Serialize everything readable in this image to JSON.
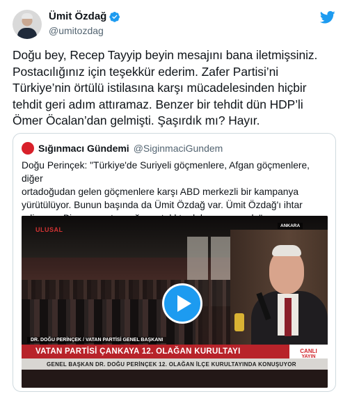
{
  "author": {
    "name": "Ümit Özdağ",
    "handle": "@umitozdag",
    "verified": true
  },
  "tweet": {
    "text": "Doğu bey, Recep Tayyip beyin mesajını bana iletmişsiniz.\nPostacılığınız için teşekkür ederim. Zafer Partisi’ni\nTürkiye’nin örtülü istilasına karşı mücadelesinden hiçbir\ntehdit geri adım attıramaz. Benzer bir tehdit dün HDP’li\nÖmer Öcalan’dan gelmişti. Şaşırdık mı? Hayır."
  },
  "quoted": {
    "name": "Sığınmacı Gündemi",
    "handle": "@SiginmaciGundem",
    "text": "Doğu Perinçek: \"Türkiye'de Suriyeli göçmenlere, Afgan göçmenlere, diğer\nortadoğudan gelen göçmenlere karşı ABD merkezli bir kampanya\nyürütülüyor. Bunun başında da Ümit Özdağ var. Ümit Özdağ'ı ihtar\nediyoruz. Biz onu pıstıracağız, ortalıkta dolaşamayacak.\"",
    "video": {
      "channel_logo": "ULUSAL",
      "location": "ANKARA",
      "speaker_label": "DR. DOĞU PERİNÇEK / VATAN PARTİSİ GENEL BAŞKANI",
      "headline": "VATAN PARTİSİ ÇANKAYA 12. OLAĞAN KURULTAYI",
      "live_label_1": "CANLI",
      "live_label_2": "YAYIN",
      "subline": "GENEL BAŞKAN DR. DOĞU PERİNÇEK 12. OLAĞAN İLÇE KURULTAYINDA KONUŞUYOR"
    }
  },
  "colors": {
    "twitter_blue": "#1d9bf0",
    "text": "#0f1419",
    "muted": "#536471",
    "border": "#cfd9de",
    "banner_red": "#b8232a"
  },
  "icons": {
    "verified": "verified-badge-icon",
    "brand": "twitter-bird-icon",
    "play": "play-icon"
  }
}
